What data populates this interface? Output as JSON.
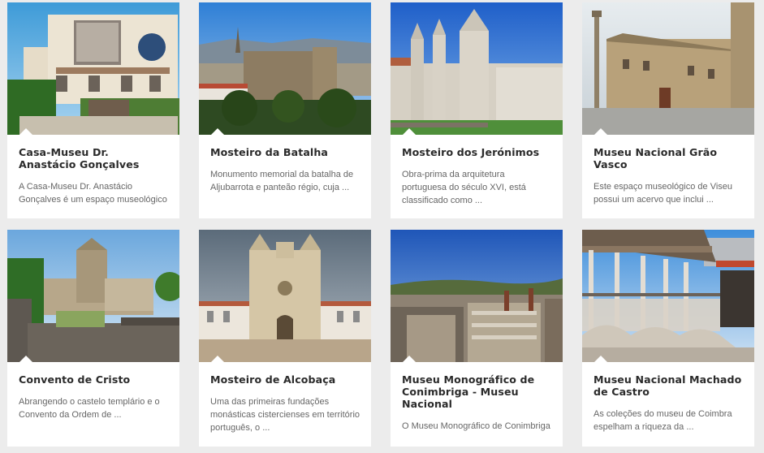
{
  "cards": [
    {
      "title": "Casa-Museu Dr. Anastácio Gonçalves",
      "description": "A Casa-Museu Dr. Anastácio Gonçalves é um espaço museológico",
      "image": "casa-museu-building-photo"
    },
    {
      "title": "Mosteiro da Batalha",
      "description": "Monumento memorial da batalha de Aljubarrota e panteão régio, cuja ...",
      "image": "batalha-monastery-photo"
    },
    {
      "title": "Mosteiro dos Jerónimos",
      "description": "Obra-prima da arquitetura portuguesa do século XVI, está classificado como ...",
      "image": "jeronimos-monastery-photo"
    },
    {
      "title": "Museu Nacional Grão Vasco",
      "description": "Este espaço museológico de Viseu possui um acervo que inclui ...",
      "image": "grao-vasco-museum-photo"
    },
    {
      "title": "Convento de Cristo",
      "description": "Abrangendo o castelo templário e o Convento da Ordem de ...",
      "image": "convento-cristo-photo"
    },
    {
      "title": "Mosteiro de Alcobaça",
      "description": "Uma das primeiras fundações monásticas cistercienses em território português, o ...",
      "image": "alcobaca-monastery-photo"
    },
    {
      "title": "Museu Monográfico de Conimbriga - Museu Nacional",
      "description": "O Museu Monográfico de Conimbriga",
      "image": "conimbriga-ruins-photo"
    },
    {
      "title": "Museu Nacional Machado de Castro",
      "description": "As coleções do museu de Coimbra espelham a riqueza da ...",
      "image": "machado-castro-museum-photo"
    }
  ]
}
